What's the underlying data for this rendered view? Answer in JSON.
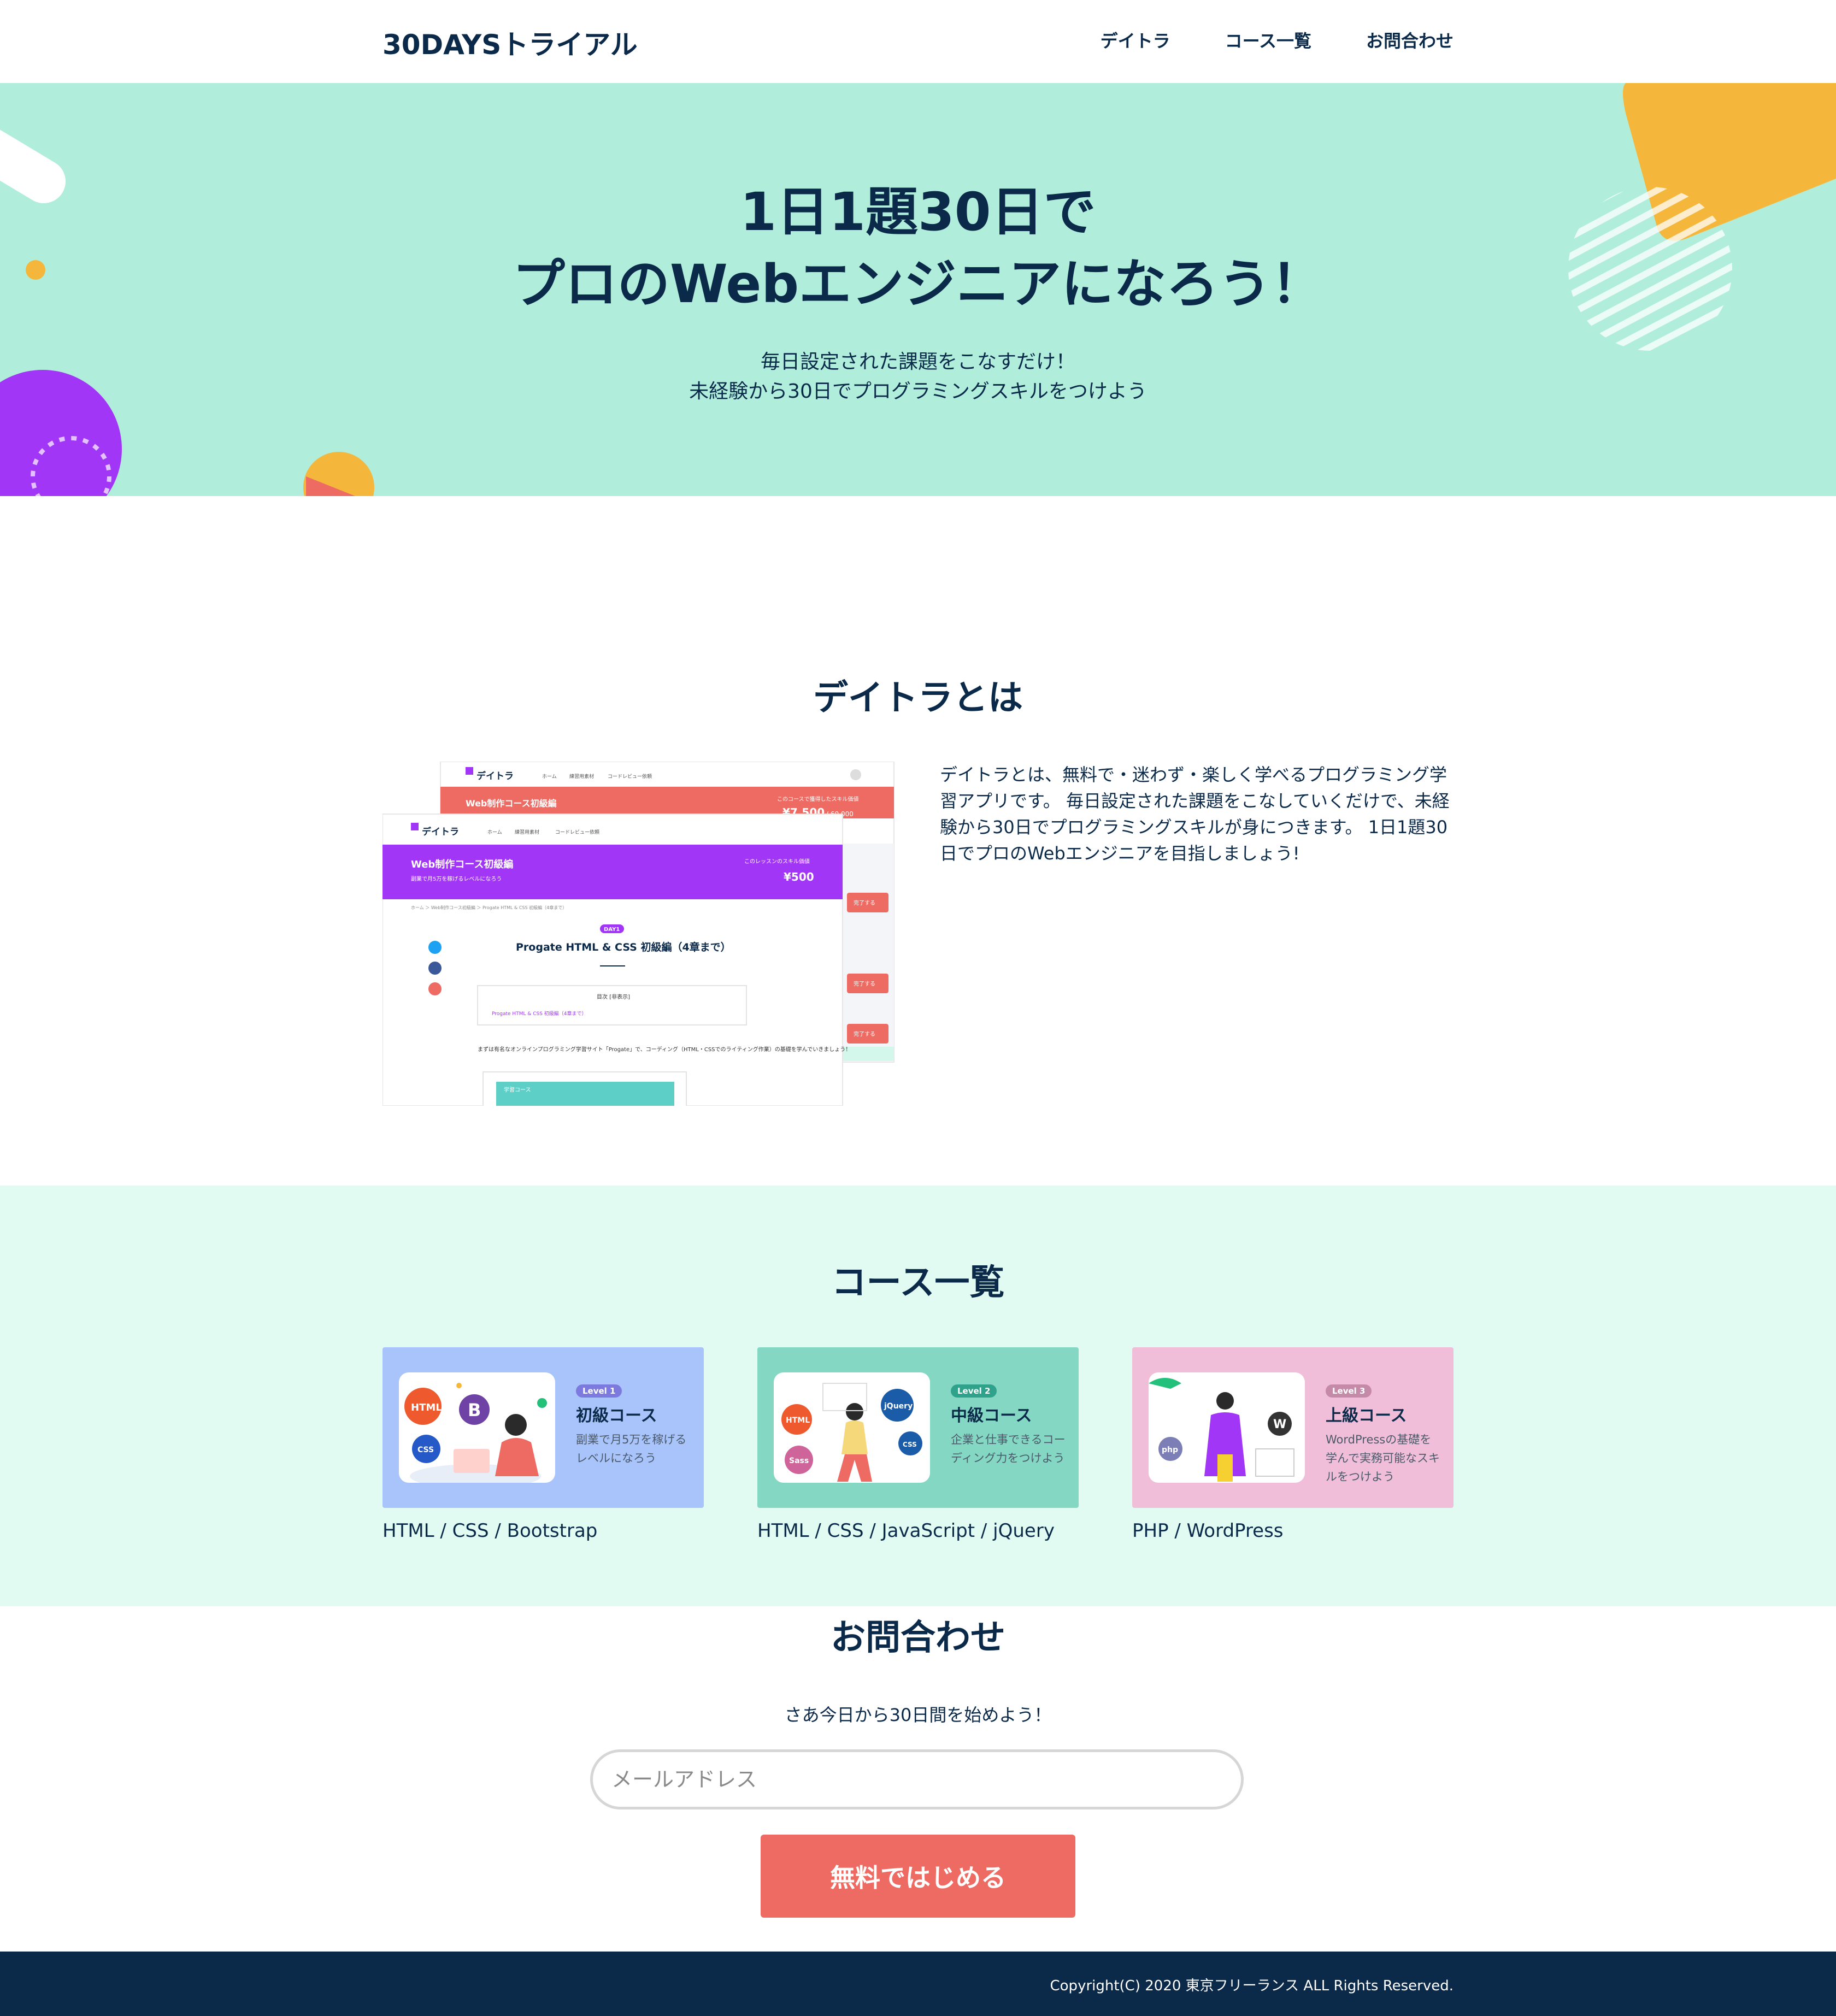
{
  "header": {
    "logo": "30DAYSトライアル",
    "nav": [
      "デイトラ",
      "コース一覧",
      "お問合わせ"
    ]
  },
  "hero": {
    "title_line1": "1日1題30日で",
    "title_line2": "プロのWebエンジニアになろう！",
    "sub_line1": "毎日設定された課題をこなすだけ！",
    "sub_line2": "未経験から30日でプログラミングスキルをつけよう"
  },
  "about": {
    "title": "デイトラとは",
    "text": "デイトラとは、無料で・迷わず・楽しく学べるプログラミング学習アプリです。 毎日設定された課題をこなしていくだけで、未経験から30日でプログラミングスキルが身につきます。 1日1題30日でプロのWebエンジニアを目指しましょう!",
    "screenshot": {
      "brand": "デイトラ",
      "nav": [
        "ホーム",
        "練習用素材",
        "コードレビュー依頼"
      ],
      "back_course": "Web制作コース初級編",
      "back_skill_label": "このコースで獲得したスキル価値",
      "back_price": "¥7,500",
      "back_total": "/ 60,000",
      "front_course": "Web制作コース初級編",
      "front_course_sub": "副業で月5万を稼げるレベルになろう",
      "front_skill_label": "このレッスンのスキル価値",
      "front_price": "¥500",
      "breadcrumb": "ホーム ＞ Web制作コース初級編 ＞ Progate HTML & CSS 初級編（4章まで）",
      "day_badge": "DAY1",
      "lesson_title": "Progate HTML & CSS 初級編（4章まで）",
      "toc_label": "目次 [非表示]",
      "toc_item": "Progate HTML & CSS 初級編（4章まで）",
      "body_text": "まずは有名なオンラインプログラミング学習サイト「Progate」で、コーディング（HTML・CSSでのライティング作業）の基礎を学んでいきましょう！",
      "mini_label": "学習コース",
      "side_button": "完了する"
    }
  },
  "courses": {
    "title": "コース一覧",
    "items": [
      {
        "level": "Level 1",
        "name": "初級コース",
        "desc": "副業で月5万を稼げるレベルになろう",
        "tech": "HTML / CSS / Bootstrap",
        "bg": "#a8c4fb",
        "badge": "#7d7adf"
      },
      {
        "level": "Level 2",
        "name": "中級コース",
        "desc": "企業と仕事できるコーディング力をつけよう",
        "tech": "HTML / CSS / JavaScript / jQuery",
        "bg": "#84d8c3",
        "badge": "#2ea28a"
      },
      {
        "level": "Level 3",
        "name": "上級コース",
        "desc": "WordPressの基礎を学んで実務可能なスキルをつけよう",
        "tech": "PHP / WordPress",
        "bg": "#f0bed8",
        "badge": "#c48aa8"
      }
    ]
  },
  "contact": {
    "title": "お問合わせ",
    "lead": "さあ今日から30日間を始めよう！",
    "email_placeholder": "メールアドレス",
    "button": "無料ではじめる"
  },
  "footer": {
    "copyright": "Copyright(C) 2020 東京フリーランス ALL Rights Reserved."
  },
  "colors": {
    "navy": "#0b2a4a",
    "hero_bg": "#b0eedb",
    "courses_bg": "#e1fbf2",
    "cta": "#ee6b63",
    "purple": "#a236f7",
    "coral": "#ee6b63"
  }
}
